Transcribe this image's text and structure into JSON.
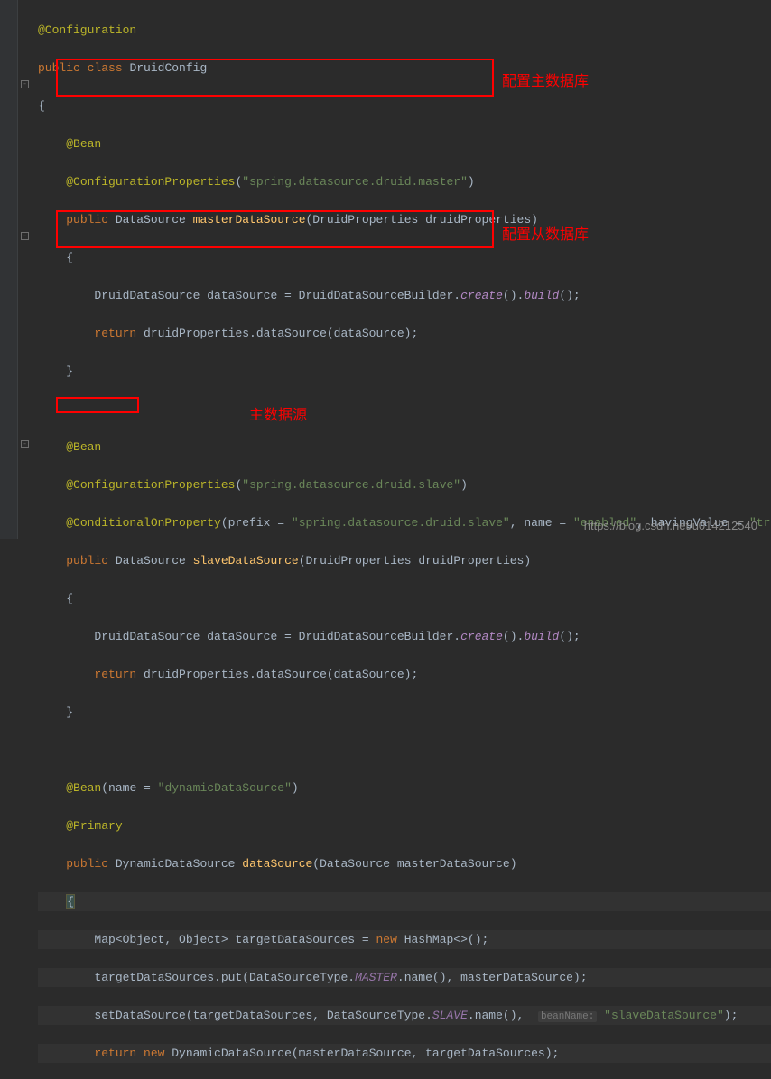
{
  "annotations": {
    "box1_label": "配置主数据库",
    "box2_label": "配置从数据库",
    "box3_label": "主数据源"
  },
  "code": {
    "l0": "@Configuration",
    "l1_kw1": "public",
    "l1_kw2": "class",
    "l1_cls": "DruidConfig",
    "l2": "{",
    "l4a": "@Bean",
    "l5a": "@ConfigurationProperties",
    "l5s": "\"spring.datasource.druid.master\"",
    "l6_kw": "public",
    "l6_cls": "DataSource",
    "l6_m": "masterDataSource",
    "l6_p": "(DruidProperties druidProperties)",
    "l7": "{",
    "l8_a": "DruidDataSource dataSource = DruidDataSourceBuilder.",
    "l8_m1": "create",
    "l8_b": "().",
    "l8_m2": "build",
    "l8_c": "();",
    "l9_kw": "return",
    "l9_a": " druidProperties.dataSource(dataSource);",
    "l10": "}",
    "l12a": "@Bean",
    "l13a": "@ConfigurationProperties",
    "l13s": "\"spring.datasource.druid.slave\"",
    "l14a": "@ConditionalOnProperty",
    "l14_lp": "prefix = ",
    "l14s1": "\"spring.datasource.druid.slave\"",
    "l14_ln": ", name = ",
    "l14s2": "\"enabled\"",
    "l14_lh": ", havingValue = ",
    "l14s3": "\"tru",
    "l15_kw": "public",
    "l15_cls": "DataSource",
    "l15_m": "slaveDataSource",
    "l15_p": "(DruidProperties druidProperties)",
    "l16": "{",
    "l17_a": "DruidDataSource dataSource = DruidDataSourceBuilder.",
    "l17_m1": "create",
    "l17_b": "().",
    "l17_m2": "build",
    "l17_c": "();",
    "l18_kw": "return",
    "l18_a": " druidProperties.dataSource(dataSource);",
    "l19": "}",
    "l21a": "@Bean",
    "l21_lp": "(name = ",
    "l21s": "\"dynamicDataSource\"",
    "l21_rp": ")",
    "l22a": "@Primary",
    "l23_kw": "public",
    "l23_cls": "DynamicDataSource",
    "l23_m": "dataSource",
    "l23_p": "(DataSource masterDataSource)",
    "l24": "{",
    "l25_a": "Map<Object, Object> targetDataSources = ",
    "l25_kw": "new",
    "l25_b": " HashMap<>();",
    "l26_a": "targetDataSources.put(DataSourceType.",
    "l26_f": "MASTER",
    "l26_b": ".name(), masterDataSource);",
    "l27_a": "setDataSource(targetDataSources, DataSourceType.",
    "l27_f": "SLAVE",
    "l27_b": ".name(), ",
    "l27_hint": "beanName:",
    "l27_s": "\"slaveDataSource\"",
    "l27_c": ");",
    "l28_kw": "return",
    "l28_kw2": "new",
    "l28_a": " DynamicDataSource(masterDataSource, targetDataSources);"
  },
  "watermark": "https://blog.csdn.net/u014212540"
}
